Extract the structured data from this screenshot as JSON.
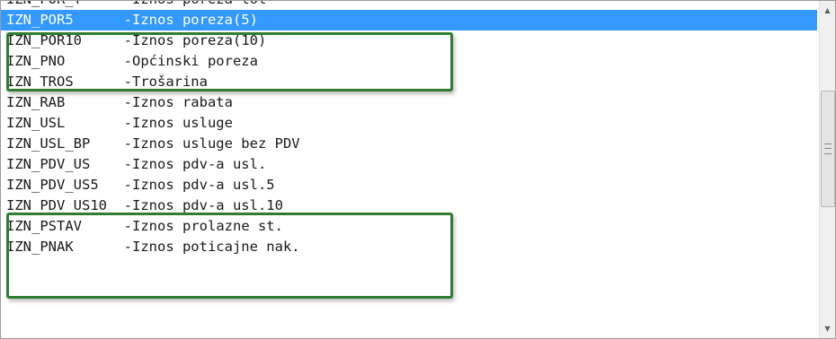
{
  "list": {
    "items": [
      {
        "code": "IZN_POR_T",
        "desc": "-Iznos poreza tol"
      },
      {
        "code": "IZN_POR5",
        "desc": "-Iznos poreza(5)",
        "selected": true
      },
      {
        "code": "IZN_POR10",
        "desc": "-Iznos poreza(10)"
      },
      {
        "code": "IZN_PNO",
        "desc": "-Općinski poreza"
      },
      {
        "code": "IZN_TROS",
        "desc": "-Trošarina"
      },
      {
        "code": "IZN_RAB",
        "desc": "-Iznos rabata"
      },
      {
        "code": "IZN_USL",
        "desc": "-Iznos usluge"
      },
      {
        "code": "IZN_USL_BP",
        "desc": "-Iznos usluge bez PDV"
      },
      {
        "code": "IZN_PDV_US",
        "desc": "-Iznos pdv-a usl."
      },
      {
        "code": "IZN_PDV_US5",
        "desc": "-Iznos pdv-a usl.5"
      },
      {
        "code": "IZN_PDV_US10",
        "desc": "-Iznos pdv-a usl.10"
      },
      {
        "code": "IZN_PSTAV",
        "desc": "-Iznos prolazne st."
      },
      {
        "code": "IZN_PNAK",
        "desc": "-Iznos poticajne nak."
      }
    ],
    "selected_index": 1
  },
  "colors": {
    "selection": "#3399ff",
    "highlight_border": "#2e7d32",
    "text": "#1a1a1a"
  },
  "icons": {
    "scroll_up": "triangle-up",
    "scroll_down": "triangle-down"
  }
}
